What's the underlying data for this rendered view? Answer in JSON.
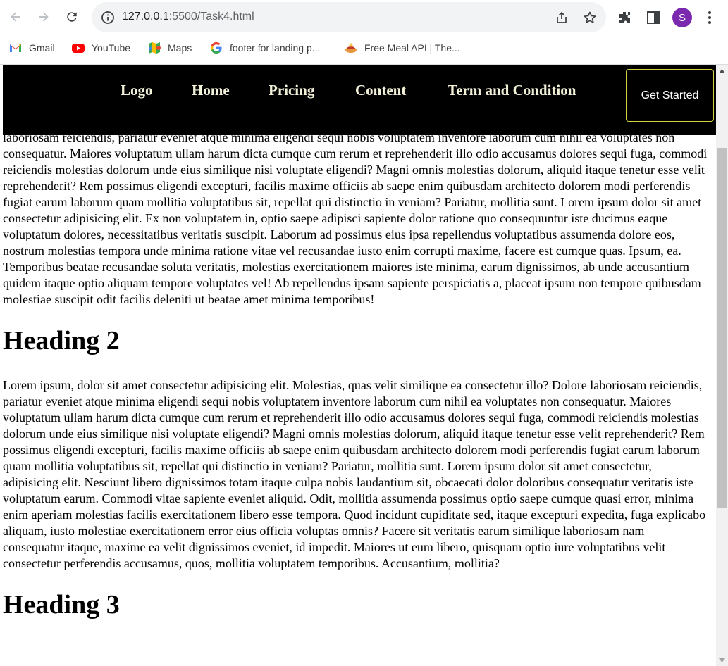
{
  "browser": {
    "url_host": "127.0.0.1",
    "url_rest": ":5500/Task4.html",
    "profile_initial": "S",
    "icons": [
      "back-arrow-icon",
      "forward-arrow-icon",
      "reload-icon",
      "info-icon",
      "share-icon",
      "star-icon",
      "extensions-icon",
      "side-panel-icon",
      "more-vert-icon"
    ],
    "bookmarks": [
      {
        "label": "Gmail",
        "icon": "gmail-icon"
      },
      {
        "label": "YouTube",
        "icon": "youtube-icon"
      },
      {
        "label": "Maps",
        "icon": "maps-icon"
      },
      {
        "label": "footer for landing p...",
        "icon": "google-icon"
      },
      {
        "label": "Free Meal API | The...",
        "icon": "meal-icon"
      }
    ]
  },
  "page": {
    "nav": {
      "links": [
        "Logo",
        "Home",
        "Pricing",
        "Content",
        "Term and Condition"
      ],
      "cta": "Get Started",
      "background": "#000000",
      "link_color": "#f2f0d6",
      "cta_border": "#d4cf3c"
    },
    "paragraph_1": "laboriosam reiciendis, pariatur eveniet atque minima eligendi sequi nobis voluptatem inventore laborum cum nihil ea voluptates non consequatur. Maiores voluptatum ullam harum dicta cumque cum rerum et reprehenderit illo odio accusamus dolores sequi fuga, commodi reiciendis molestias dolorum unde eius similique nisi voluptate eligendi? Magni omnis molestias dolorum, aliquid itaque tenetur esse velit reprehenderit? Rem possimus eligendi excepturi, facilis maxime officiis ab saepe enim quibusdam architecto dolorem modi perferendis fugiat earum laborum quam mollitia voluptatibus sit, repellat qui distinctio in veniam? Pariatur, mollitia sunt. Lorem ipsum dolor sit amet consectetur adipisicing elit. Ex non voluptatem in, optio saepe adipisci sapiente dolor ratione quo consequuntur iste ducimus eaque voluptatum dolores, necessitatibus veritatis suscipit. Laborum ad possimus eius ipsa repellendus voluptatibus assumenda dolore eos, nostrum molestias tempora unde minima ratione vitae vel recusandae iusto enim corrupti maxime, facere est cumque quas. Ipsum, ea. Temporibus beatae recusandae soluta veritatis, molestias exercitationem maiores iste minima, earum dignissimos, ab unde accusantium quidem itaque optio aliquam tempore voluptates vel! Ab repellendus ipsam sapiente perspiciatis a, placeat ipsum non tempore quibusdam molestiae suscipit odit facilis deleniti ut beatae amet minima temporibus!",
    "heading_2": "Heading 2",
    "paragraph_2": "Lorem ipsum, dolor sit amet consectetur adipisicing elit. Molestias, quas velit similique ea consectetur illo? Dolore laboriosam reiciendis, pariatur eveniet atque minima eligendi sequi nobis voluptatem inventore laborum cum nihil ea voluptates non consequatur. Maiores voluptatum ullam harum dicta cumque cum rerum et reprehenderit illo odio accusamus dolores sequi fuga, commodi reiciendis molestias dolorum unde eius similique nisi voluptate eligendi? Magni omnis molestias dolorum, aliquid itaque tenetur esse velit reprehenderit? Rem possimus eligendi excepturi, facilis maxime officiis ab saepe enim quibusdam architecto dolorem modi perferendis fugiat earum laborum quam mollitia voluptatibus sit, repellat qui distinctio in veniam? Pariatur, mollitia sunt. Lorem ipsum dolor sit amet consectetur, adipisicing elit. Nesciunt libero dignissimos totam itaque culpa nobis laudantium sit, obcaecati dolor doloribus consequatur veritatis iste voluptatum earum. Commodi vitae sapiente eveniet aliquid. Odit, mollitia assumenda possimus optio saepe cumque quasi error, minima enim aperiam molestias facilis exercitationem libero esse tempora. Quod incidunt cupiditate sed, itaque excepturi expedita, fuga explicabo aliquam, iusto molestiae exercitationem error eius officia voluptas omnis? Facere sit veritatis earum similique laboriosam nam consequatur itaque, maxime ea velit dignissimos eveniet, id impedit. Maiores ut eum libero, quisquam optio iure voluptatibus velit consectetur perferendis accusamus, quos, mollitia voluptatem temporibus. Accusantium, mollitia?",
    "heading_3": "Heading 3"
  }
}
